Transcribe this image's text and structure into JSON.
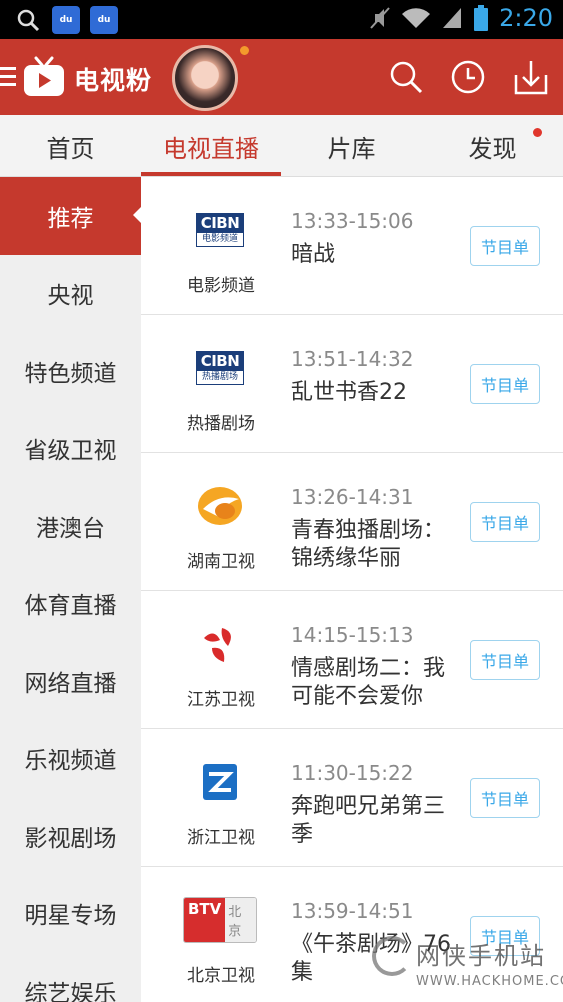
{
  "status_bar": {
    "time": "2:20"
  },
  "app_bar": {
    "title": "电视粉"
  },
  "tabs": [
    {
      "label": "首页"
    },
    {
      "label": "电视直播"
    },
    {
      "label": "片库"
    },
    {
      "label": "发现"
    }
  ],
  "sidebar": {
    "items": [
      {
        "label": "推荐"
      },
      {
        "label": "央视"
      },
      {
        "label": "特色频道"
      },
      {
        "label": "省级卫视"
      },
      {
        "label": "港澳台"
      },
      {
        "label": "体育直播"
      },
      {
        "label": "网络直播"
      },
      {
        "label": "乐视频道"
      },
      {
        "label": "影视剧场"
      },
      {
        "label": "明星专场"
      },
      {
        "label": "综艺娱乐"
      }
    ]
  },
  "channels": [
    {
      "name": "电影频道",
      "logo_text": "CIBN",
      "logo_sub": "电影频道",
      "time": "13:33-15:06",
      "program": "暗战",
      "guide_label": "节目单"
    },
    {
      "name": "热播剧场",
      "logo_text": "CIBN",
      "logo_sub": "热播剧场",
      "time": "13:51-14:32",
      "program": "乱世书香22",
      "guide_label": "节目单"
    },
    {
      "name": "湖南卫视",
      "time": "13:26-14:31",
      "program": "青春独播剧场：锦绣缘华丽",
      "guide_label": "节目单"
    },
    {
      "name": "江苏卫视",
      "time": "14:15-15:13",
      "program": "情感剧场二：我可能不会爱你",
      "guide_label": "节目单"
    },
    {
      "name": "浙江卫视",
      "time": "11:30-15:22",
      "program": "奔跑吧兄弟第三季",
      "guide_label": "节目单"
    },
    {
      "name": "北京卫视",
      "logo_text": "BTV",
      "logo_sub": "北京",
      "time": "13:59-14:51",
      "program": "《午茶剧场》76集",
      "guide_label": "节目单"
    }
  ],
  "watermark": {
    "line1": "网侠手机站",
    "line2": "WWW.HACKHOME.COM"
  },
  "colors": {
    "primary": "#c5392d",
    "accent_blue": "#3aa8e8",
    "sidebar_bg": "#efefef"
  }
}
